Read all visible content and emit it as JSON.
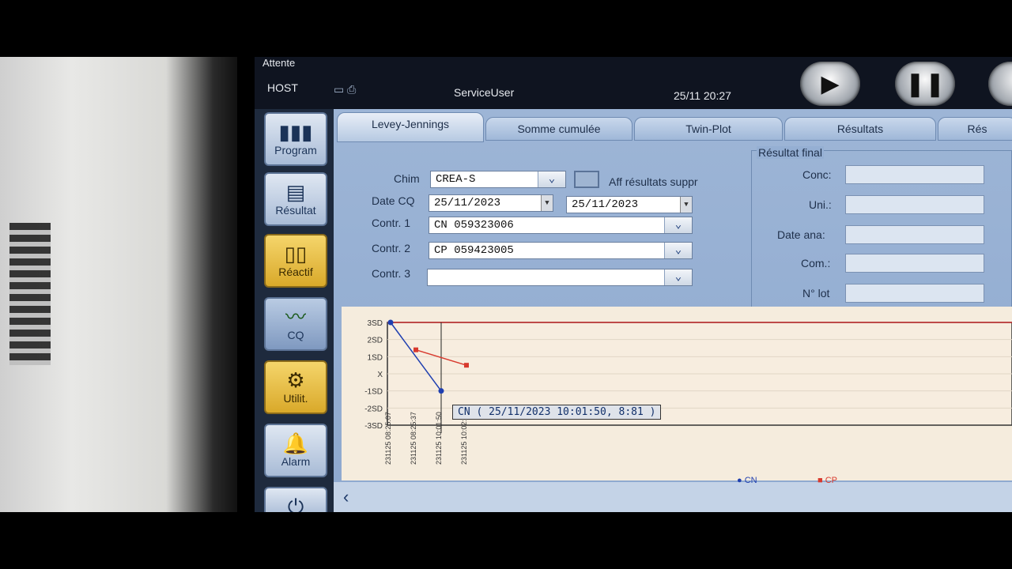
{
  "status": {
    "state": "Attente",
    "host": "HOST",
    "user": "ServiceUser",
    "datetime": "25/11 20:27"
  },
  "sidebar": [
    {
      "label": "Program",
      "icon": "program-icon"
    },
    {
      "label": "Résultat",
      "icon": "result-icon"
    },
    {
      "label": "Réactif",
      "icon": "reagent-icon"
    },
    {
      "label": "CQ",
      "icon": "qc-chart-icon"
    },
    {
      "label": "Utilit.",
      "icon": "utility-icon"
    },
    {
      "label": "Alarm",
      "icon": "bell-icon"
    }
  ],
  "tabs": [
    "Levey-Jennings",
    "Somme cumulée",
    "Twin-Plot",
    "Résultats",
    "Rés"
  ],
  "form": {
    "chim_label": "Chim",
    "chim_value": "CREA-S",
    "aff_label": "Aff résultats suppr",
    "date_label": "Date CQ",
    "date_from": "25/11/2023",
    "date_to": "25/11/2023",
    "c1_label": "Contr. 1",
    "c1_value": "CN  059323006",
    "c2_label": "Contr. 2",
    "c2_value": "CP 059423005",
    "c3_label": "Contr. 3",
    "c3_value": ""
  },
  "final": {
    "title": "Résultat final",
    "labels": [
      "Conc:",
      "Uni.:",
      "Date ana:",
      "Com.:",
      "N° lot"
    ]
  },
  "chart_data": {
    "type": "line",
    "y_ticks": [
      "3SD",
      "2SD",
      "1SD",
      "X",
      "-1SD",
      "-2SD",
      "-3SD"
    ],
    "ylim": [
      -3,
      3
    ],
    "x_ticks": [
      "231125 08:25:07",
      "231125 08:25:37",
      "231125 10:01:50",
      "231125 10:02:21"
    ],
    "series": [
      {
        "name": "CN",
        "color": "#1f3fb0",
        "points": [
          [
            0,
            3
          ],
          [
            2,
            -1
          ]
        ]
      },
      {
        "name": "CP",
        "color": "#d83a2e",
        "points": [
          [
            1,
            1.4
          ],
          [
            3,
            0.5
          ]
        ]
      }
    ],
    "tooltip": "CN ( 25/11/2023 10:01:50, 8:81 )"
  }
}
